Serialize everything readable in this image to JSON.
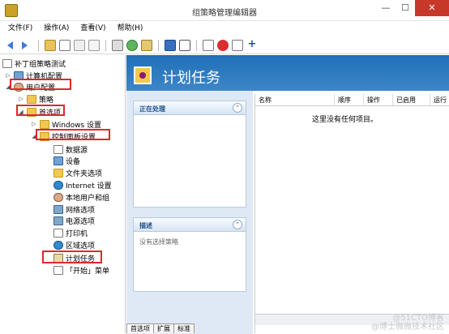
{
  "window": {
    "title": "组策略管理编辑器",
    "min": "—",
    "max": "☐",
    "close": "✕"
  },
  "menu": [
    "文件(F)",
    "操作(A)",
    "查看(V)",
    "帮助(H)"
  ],
  "tree": {
    "root": "补丁组策略测试",
    "computer_config": "计算机配置",
    "user_config": "用户配置",
    "policies": "策略",
    "preferences": "首选项",
    "windows_settings": "Windows 设置",
    "control_panel": "控制面板设置",
    "items": [
      "数据源",
      "设备",
      "文件夹选项",
      "Internet 设置",
      "本地用户和组",
      "网络选项",
      "电源选项",
      "打印机",
      "区域选项",
      "计划任务",
      "「开始」菜单"
    ]
  },
  "header": {
    "title": "计划任务"
  },
  "panes": {
    "processing_title": "正在处理",
    "description_title": "描述",
    "description_body": "没有选择策略"
  },
  "list": {
    "columns": [
      "名称",
      "顺序",
      "操作",
      "已启用",
      "运行"
    ],
    "empty_message": "这里没有任何项目。"
  },
  "tabs": [
    "首选项",
    "扩展",
    "标准"
  ],
  "watermark": {
    "line1": "@51CTO博客",
    "line2": "@博士微微技术社区"
  },
  "colors": {
    "header_blue": "#2f7bc0",
    "highlight_red": "#e0282e",
    "close_red": "#c7382b"
  }
}
